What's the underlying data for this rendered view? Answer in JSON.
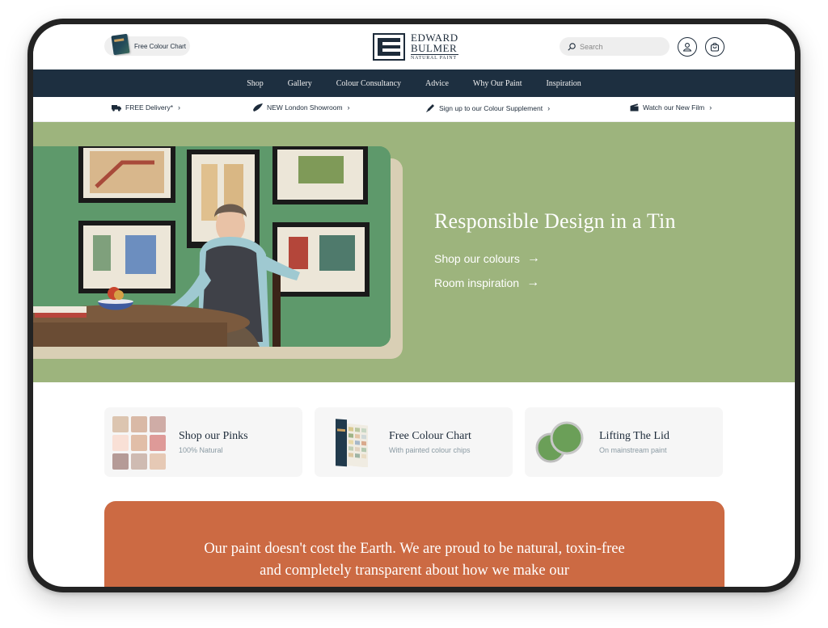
{
  "header": {
    "colour_chart_label": "Free Colour Chart",
    "logo": {
      "line1": "EDWARD",
      "line2": "BULMER",
      "line3": "NATURAL PAINT"
    },
    "search_placeholder": "Search"
  },
  "nav": {
    "items": [
      "Shop",
      "Gallery",
      "Colour Consultancy",
      "Advice",
      "Why Our Paint",
      "Inspiration"
    ]
  },
  "promo": {
    "items": [
      {
        "label": "FREE Delivery*",
        "icon": "truck-icon"
      },
      {
        "label": "NEW London Showroom",
        "icon": "brush-icon"
      },
      {
        "label": "Sign up to our Colour Supplement",
        "icon": "pen-icon"
      },
      {
        "label": "Watch our New Film",
        "icon": "clapper-icon"
      }
    ]
  },
  "hero": {
    "title": "Responsible Design in a Tin",
    "link1": "Shop our colours",
    "link2": "Room inspiration",
    "arrow": "→"
  },
  "cards": [
    {
      "title": "Shop our Pinks",
      "subtitle": "100% Natural"
    },
    {
      "title": "Free Colour Chart",
      "subtitle": "With painted colour chips"
    },
    {
      "title": "Lifting The Lid",
      "subtitle": "On mainstream paint"
    }
  ],
  "swatch_colors": [
    "#dcc5b0",
    "#d9b9a6",
    "#cfaca6",
    "#f9e0d6",
    "#e1bea8",
    "#de9a98",
    "#b59b97",
    "#cfbbb2",
    "#e6c9b5"
  ],
  "quote": {
    "text": "Our paint doesn't cost the Earth. We are proud to be natural, toxin-free and completely transparent about how we make our"
  },
  "colors": {
    "navy": "#1d2f40",
    "hero_green": "#9db47d",
    "frame_beige": "#d9cfb5",
    "terracotta": "#cc6a43"
  }
}
